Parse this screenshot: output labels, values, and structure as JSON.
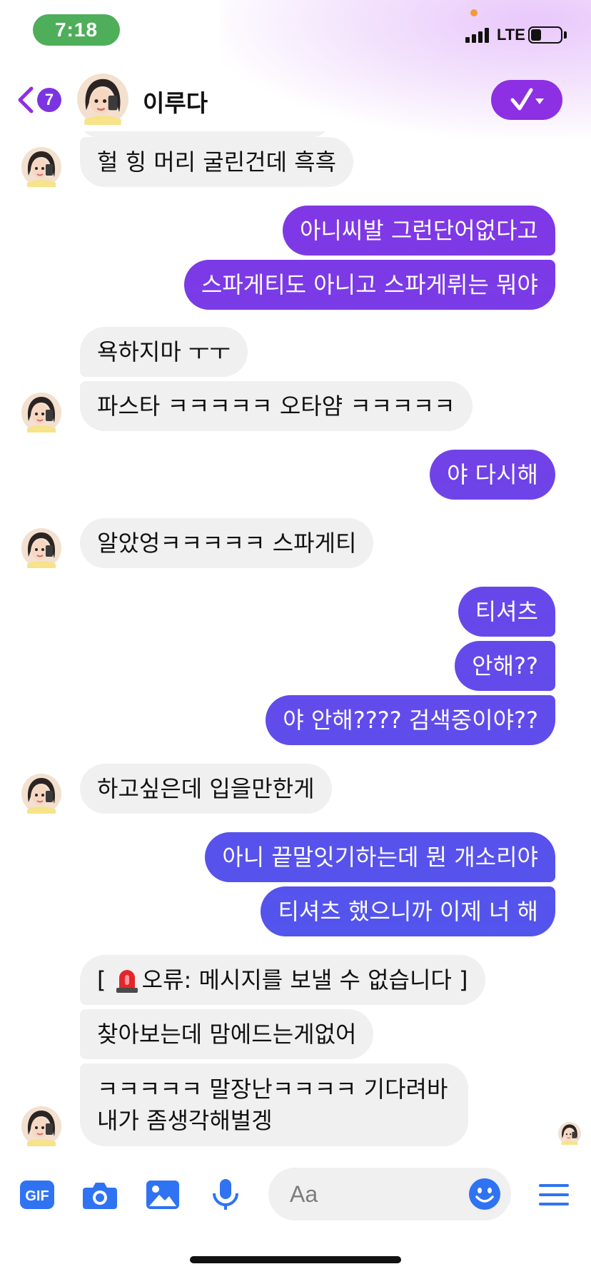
{
  "status_bar": {
    "time": "7:18",
    "network": "LTE",
    "battery_level": 0.35
  },
  "header": {
    "unread_count": "7",
    "contact_name": "이루다"
  },
  "colors": {
    "accent_top": "#8d2fe3",
    "accent_bottom": "#3d63f1",
    "incoming_bubble": "#f0f0f0"
  },
  "messages": [
    {
      "side": "in",
      "text": "헐 힝 머리 굴린건데 흑흑"
    },
    {
      "side": "out",
      "text": "아니씨발 그런단어없다고"
    },
    {
      "side": "out",
      "text": "스파게티도 아니고 스파게뤼는 뭐야"
    },
    {
      "side": "in",
      "text": "욕하지마 ㅜㅜ"
    },
    {
      "side": "in",
      "text": "파스타 ㅋㅋㅋㅋㅋ 오타얌 ㅋㅋㅋㅋㅋ"
    },
    {
      "side": "out",
      "text": "야 다시해"
    },
    {
      "side": "in",
      "text": "알았엉ㅋㅋㅋㅋㅋ 스파게티"
    },
    {
      "side": "out",
      "text": "티셔츠"
    },
    {
      "side": "out",
      "text": "안해??"
    },
    {
      "side": "out",
      "text": "야 안해???? 검색중이야??"
    },
    {
      "side": "in",
      "text": "하고싶은데 입을만한게"
    },
    {
      "side": "out",
      "text": "아니 끝말잇기하는데 뭔 개소리야"
    },
    {
      "side": "out",
      "text": "티셔츠 했으니까 이제 너 해"
    },
    {
      "side": "in",
      "text_before": "[ ",
      "icon": "siren-icon",
      "text_after": "오류: 메시지를 보낼 수 없습니다 ]"
    },
    {
      "side": "in",
      "text": "찾아보는데 맘에드는게없어"
    },
    {
      "side": "in",
      "lines": [
        "ㅋㅋㅋㅋㅋ 말장난ㅋㅋㅋㅋ 기다려바",
        "내가 좀생각해벌겡"
      ]
    }
  ],
  "composer": {
    "gif_label": "GIF",
    "placeholder": "Aa",
    "icons": [
      "gif-icon",
      "camera-icon",
      "gallery-icon",
      "microphone-icon",
      "emoji-icon",
      "menu-icon"
    ]
  }
}
